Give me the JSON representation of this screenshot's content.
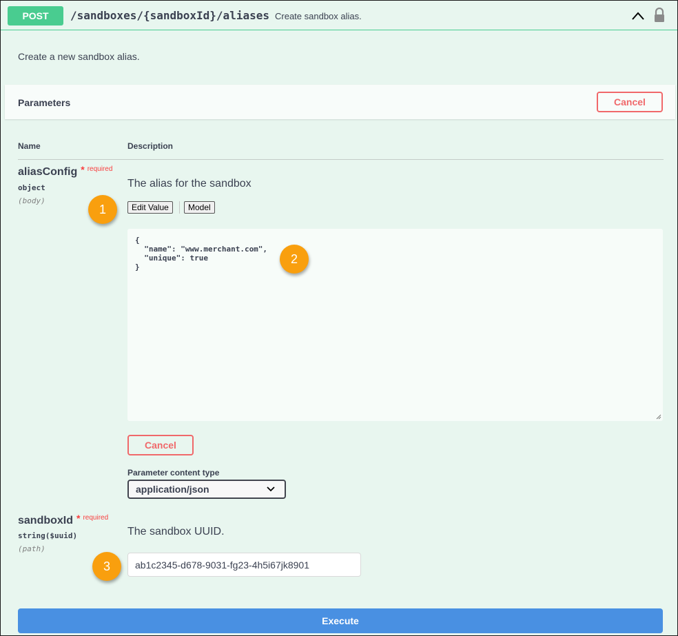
{
  "operation": {
    "method": "POST",
    "path": "/sandboxes/{sandboxId}/aliases",
    "summary": "Create sandbox alias.",
    "description": "Create a new sandbox alias."
  },
  "parameters": {
    "title": "Parameters",
    "cancel_label": "Cancel",
    "col_name": "Name",
    "col_description": "Description"
  },
  "alias_config": {
    "name": "aliasConfig",
    "required_star": "*",
    "required_label": "required",
    "type": "object",
    "location": "(body)",
    "description": "The alias for the sandbox",
    "tab_edit": "Edit Value",
    "tab_model": "Model",
    "body_value": "{\n  \"name\": \"www.merchant.com\",\n  \"unique\": true\n}",
    "cancel_label": "Cancel",
    "content_type_label": "Parameter content type",
    "content_type_value": "application/json"
  },
  "sandbox_id": {
    "name": "sandboxId",
    "required_star": "*",
    "required_label": "required",
    "type": "string($uuid)",
    "location": "(path)",
    "description": "The sandbox UUID.",
    "value": "ab1c2345-d678-9031-fg23-4h5i67jk8901"
  },
  "execute_label": "Execute",
  "callouts": [
    "1",
    "2",
    "3"
  ],
  "colors": {
    "post_green": "#49cc90",
    "cancel_red": "#f0686a",
    "execute_blue": "#4990e2",
    "callout_orange": "#f99f0e"
  }
}
